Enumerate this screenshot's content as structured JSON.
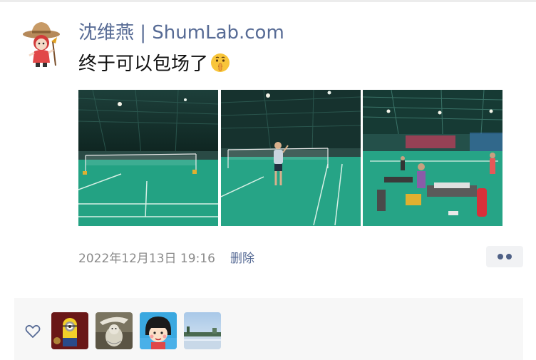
{
  "post": {
    "author": "沈维燕 | ShumLab.com",
    "text": "终于可以包场了",
    "emoji": "shushing-face-icon",
    "photos": [
      {
        "name": "badminton-court-photo-1"
      },
      {
        "name": "badminton-court-photo-2"
      },
      {
        "name": "badminton-court-photo-3"
      }
    ],
    "timestamp": "2022年12月13日 19:16",
    "delete_label": "删除",
    "more_icon": "more-dots-icon"
  },
  "likes": {
    "icon": "heart-icon",
    "users": [
      {
        "avatar": "minion-avatar"
      },
      {
        "avatar": "sketch-animal-avatar"
      },
      {
        "avatar": "cartoon-girl-avatar"
      },
      {
        "avatar": "lake-landscape-avatar"
      }
    ]
  },
  "colors": {
    "link": "#576b95",
    "text": "#111111",
    "meta": "#8a8a8a",
    "court_green": "#1f9a7a",
    "panel_bg": "#f7f7f7"
  }
}
